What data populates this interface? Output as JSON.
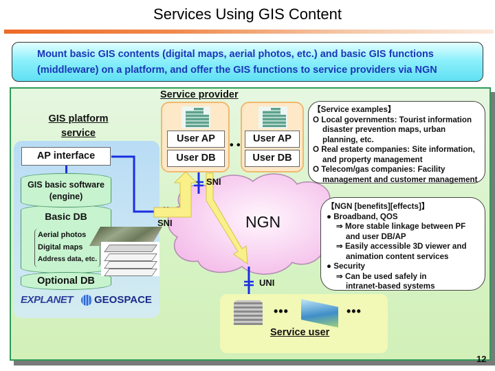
{
  "slide": {
    "title": "Services Using GIS Content",
    "page_number": "12"
  },
  "banner": {
    "line1": "Mount basic GIS contents (digital maps, aerial photos, etc.) and basic GIS functions",
    "line2": "(middleware) on a platform, and offer the GIS functions to service providers via NGN"
  },
  "gis_platform": {
    "title_line1": "GIS platform",
    "title_line2": "service",
    "ap_interface": "AP interface",
    "engine_line1": "GIS basic software",
    "engine_line2": "(engine)",
    "basic_db": "Basic DB",
    "basic_db_items": [
      "Aerial photos",
      "Digital maps",
      "Address data, etc."
    ],
    "optional_db": "Optional DB",
    "logos": [
      "EXPLANET",
      "GEOSPACE"
    ]
  },
  "service_provider": {
    "title": "Service provider",
    "boxes": [
      {
        "ap": "User AP",
        "db": "User DB"
      },
      {
        "ap": "User AP",
        "db": "User DB"
      }
    ],
    "ellipsis": "• •"
  },
  "network": {
    "ngn_label": "NGN",
    "sni_top": "SNI",
    "sni_left": "SNI",
    "uni": "UNI"
  },
  "service_examples": {
    "heading": "【Service examples】",
    "items": [
      {
        "bullet": "O",
        "line1": "Local governments: Tourist information",
        "line2": "disaster prevention maps, urban",
        "line3": "planning, etc."
      },
      {
        "bullet": "O",
        "line1": "Real estate companies: Site information,",
        "line2": "and property management"
      },
      {
        "bullet": "O",
        "line1": "Telecom/gas companies: Facility",
        "line2": "management and customer management"
      }
    ]
  },
  "ngn_benefits": {
    "heading": "【NGN [benefits][effects]】",
    "groups": [
      {
        "bullet": "●",
        "label": "Broadband, QOS",
        "effects": [
          {
            "arrow": "⇒",
            "line1": "More stable linkage between PF",
            "line2": "and user DB/AP"
          },
          {
            "arrow": "⇒",
            "line1": "Easily accessible 3D viewer and",
            "line2": "animation content services"
          }
        ]
      },
      {
        "bullet": "●",
        "label": "Security",
        "effects": [
          {
            "arrow": "⇒",
            "line1": "Can be used safely in",
            "line2": "intranet-based systems"
          }
        ]
      }
    ]
  },
  "service_user": {
    "title": "Service user",
    "ellipsis": "•••"
  },
  "colors": {
    "accent_orange": "#ee6a26",
    "banner_text": "#1a36b8",
    "panel_border": "#2e9a59",
    "connector_blue": "#1a2ee0",
    "arrow_yellow": "#f9f08a",
    "cloud_pink": "#f7c9f0"
  }
}
